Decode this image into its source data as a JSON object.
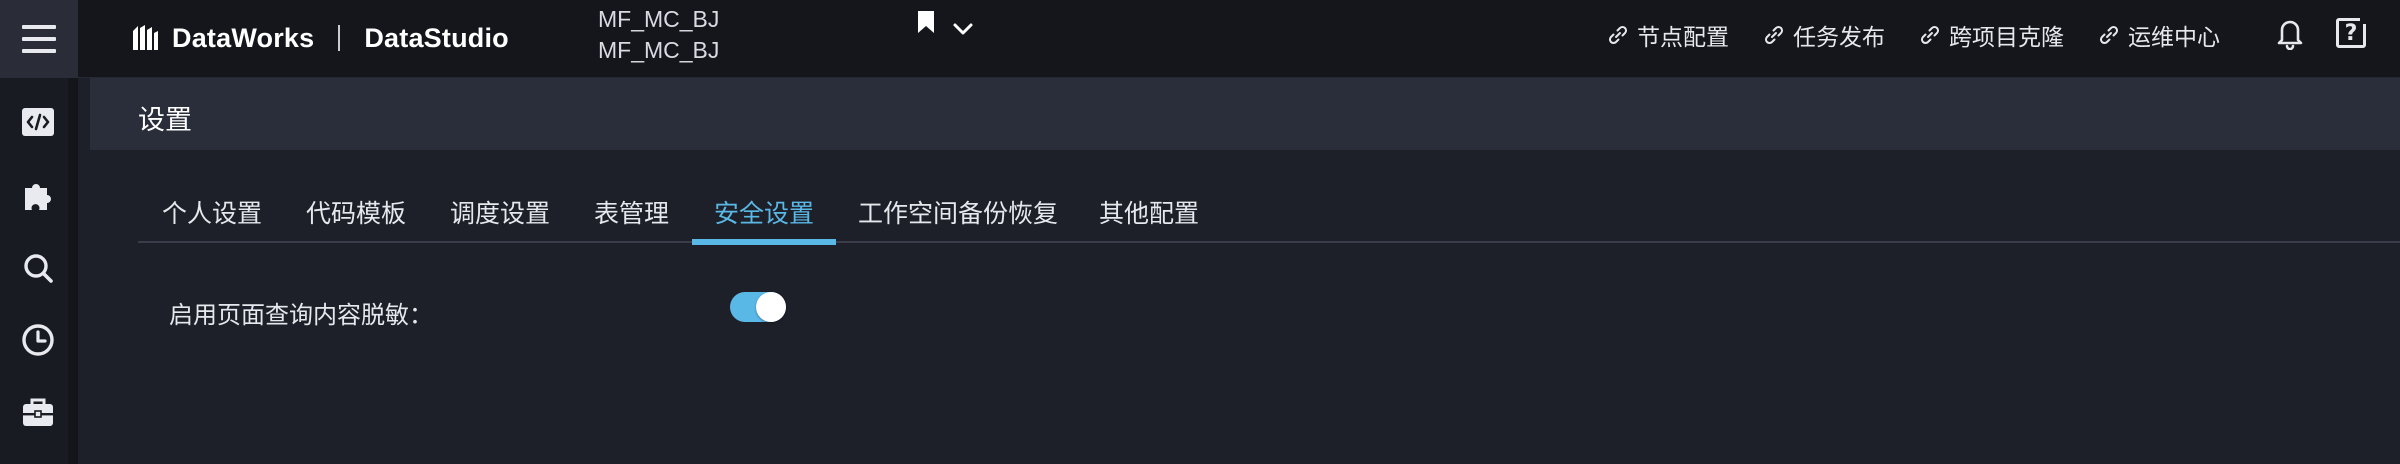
{
  "app": {
    "brand": "DataWorks",
    "module": "DataStudio",
    "workspace_line1": "MF_MC_BJ",
    "workspace_line2": "MF_MC_BJ"
  },
  "topnav": [
    {
      "label": "节点配置",
      "icon": "link-icon"
    },
    {
      "label": "任务发布",
      "icon": "link-icon"
    },
    {
      "label": "跨项目克隆",
      "icon": "link-icon"
    },
    {
      "label": "运维中心",
      "icon": "link-icon"
    }
  ],
  "header_icons": {
    "bell": "bell-icon",
    "help": "help-icon",
    "help_glyph": "?"
  },
  "rail_icons": [
    "code-icon",
    "puzzle-icon",
    "search-icon",
    "clock-icon",
    "toolbox-icon"
  ],
  "page": {
    "title": "设置"
  },
  "tabs": [
    {
      "label": "个人设置",
      "active": false
    },
    {
      "label": "代码模板",
      "active": false
    },
    {
      "label": "调度设置",
      "active": false
    },
    {
      "label": "表管理",
      "active": false
    },
    {
      "label": "安全设置",
      "active": true
    },
    {
      "label": "工作空间备份恢复",
      "active": false
    },
    {
      "label": "其他配置",
      "active": false
    }
  ],
  "settings": {
    "masking_label": "启用页面查询内容脱敏：",
    "masking_enabled": true
  },
  "colors": {
    "accent": "#5ab8e6",
    "topbar_bg": "#14161c",
    "page_bg": "#1e2029",
    "header_bg": "#2a2d3a"
  }
}
